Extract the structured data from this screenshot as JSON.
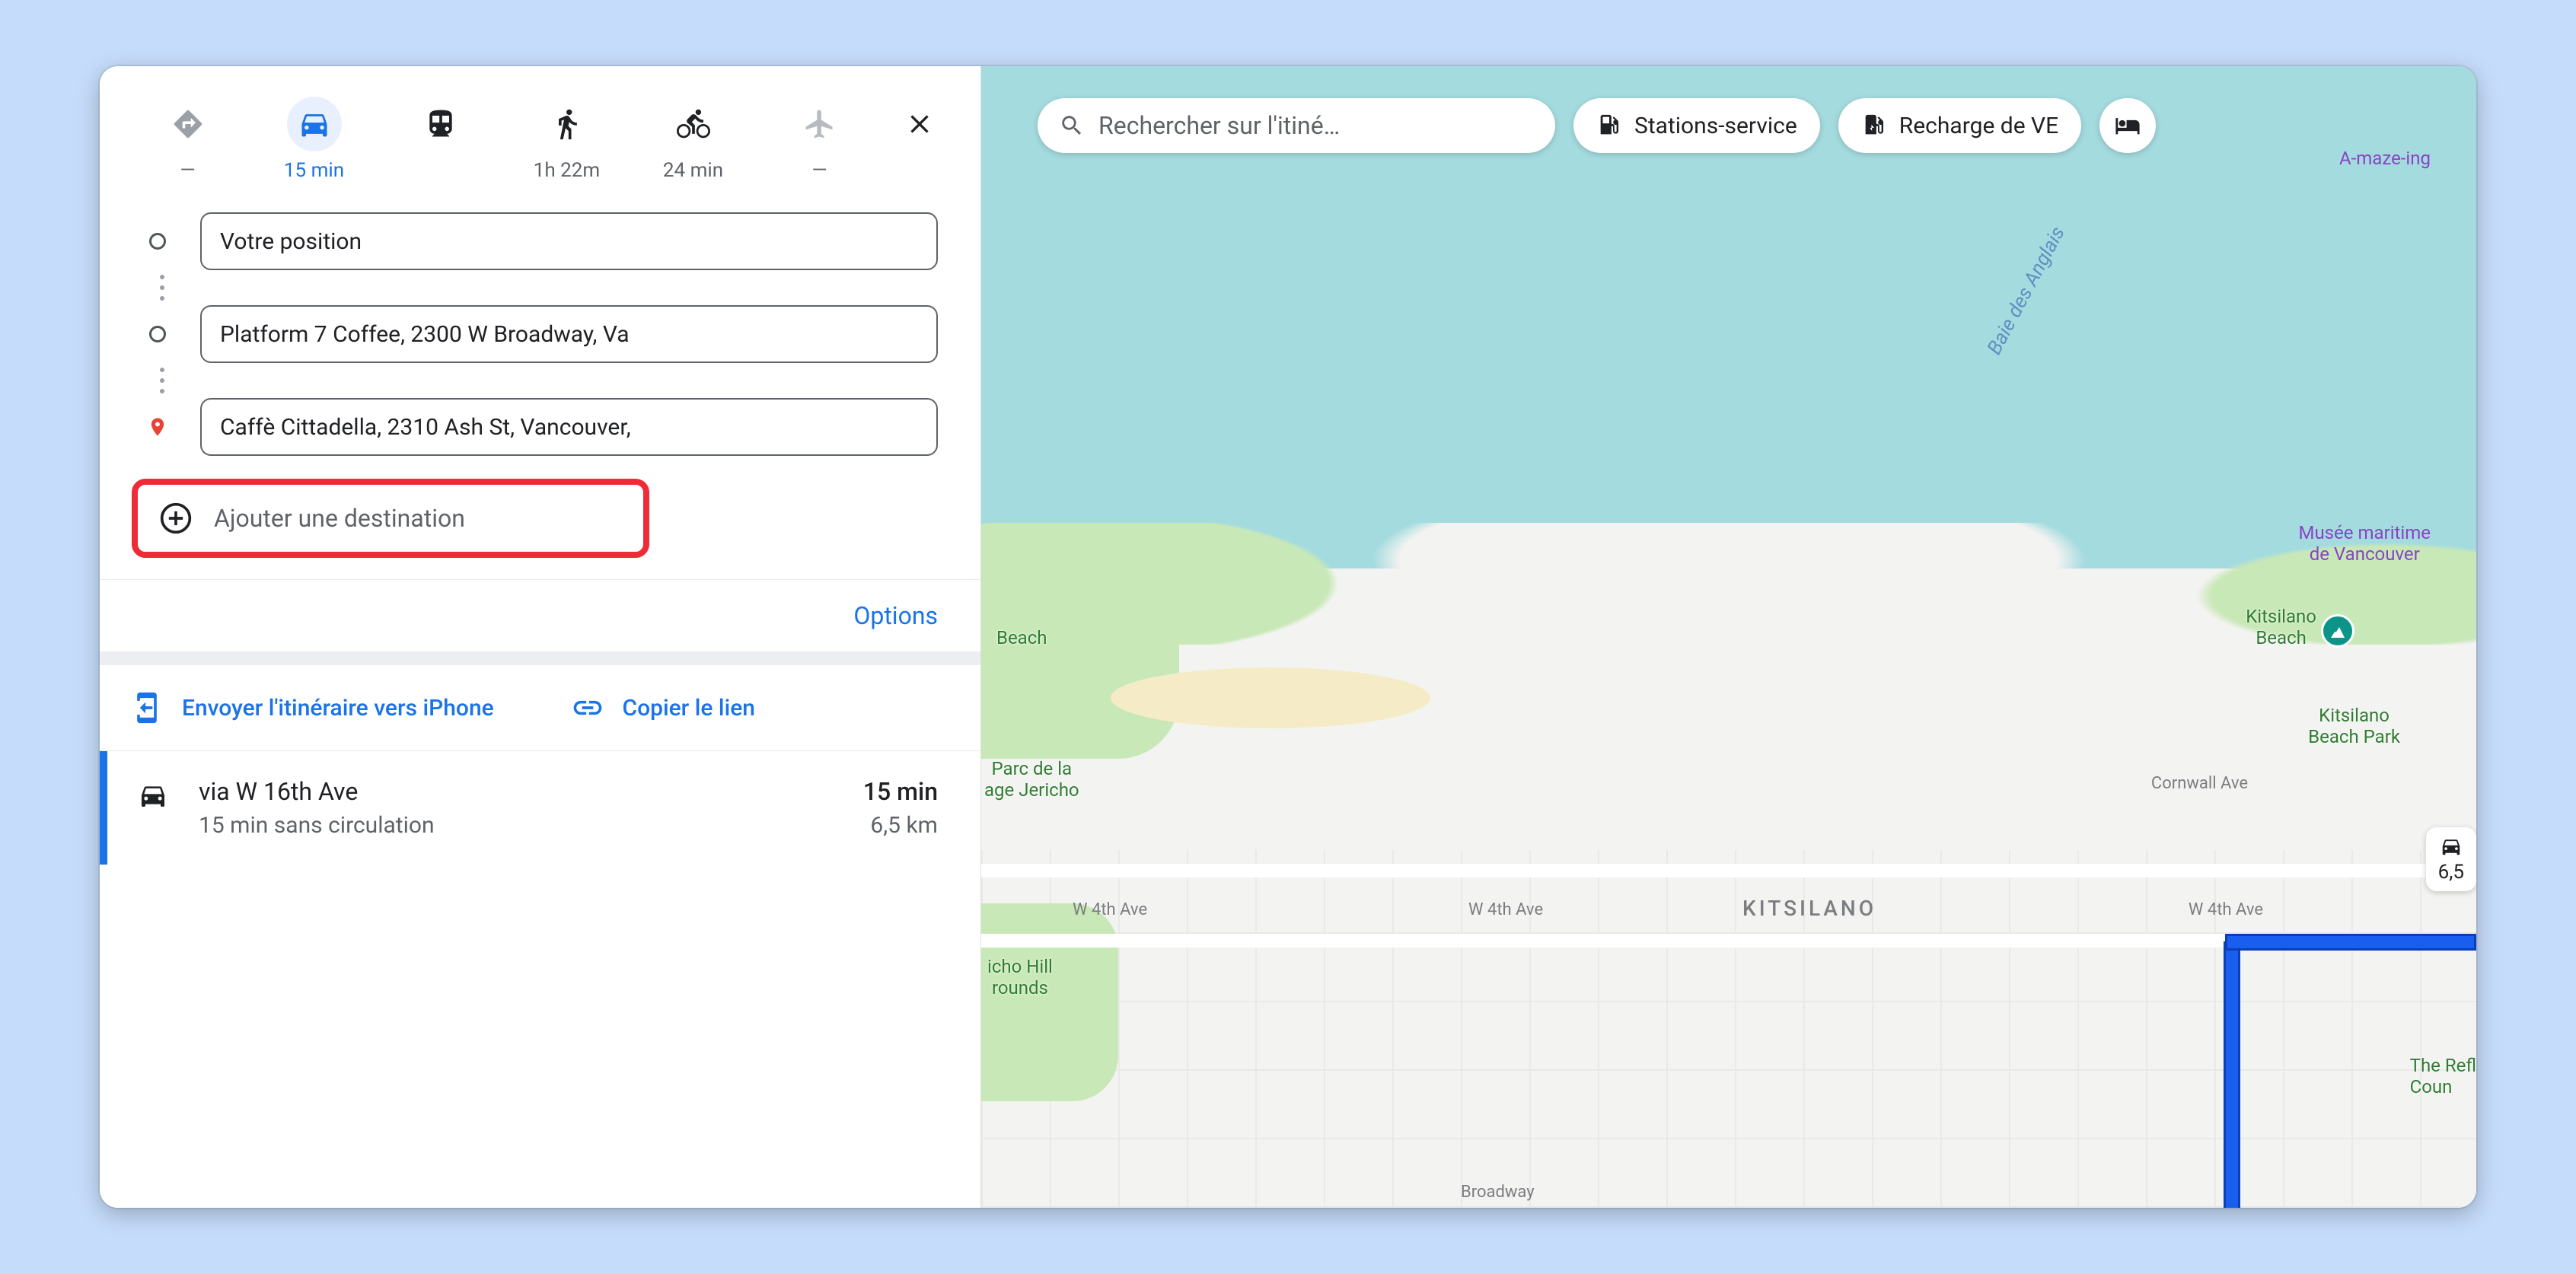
{
  "modes": {
    "best": {
      "time": "—"
    },
    "car": {
      "time": "15 min"
    },
    "transit": {
      "time": ""
    },
    "walk": {
      "time": "1h 22m"
    },
    "bike": {
      "time": "24 min"
    },
    "plane": {
      "time": "—"
    }
  },
  "waypoints": {
    "start": "Votre position",
    "mid": "Platform 7 Coffee, 2300 W Broadway, Va",
    "end": "Caffè Cittadella, 2310 Ash St, Vancouver,"
  },
  "add_destination": "Ajouter une destination",
  "options_label": "Options",
  "actions": {
    "send": "Envoyer l'itinéraire vers iPhone",
    "copy": "Copier le lien"
  },
  "route": {
    "title": "via W 16th Ave",
    "sub": "15 min sans circulation",
    "time": "15 min",
    "distance": "6,5 km"
  },
  "search_placeholder": "Rechercher sur l'itiné…",
  "chips": {
    "gas": "Stations-service",
    "ev": "Recharge de VE"
  },
  "map_labels": {
    "bay": "Baie des Anglais",
    "amaze": "A-maze-ing",
    "museum": "Musée maritime\nde Vancouver",
    "kits_beach": "Kitsilano\nBeach",
    "kits_park": "Kitsilano\nBeach Park",
    "cornwall": "Cornwall Ave",
    "beach": "Beach",
    "jericho": "Parc de la\nage Jericho",
    "w4th_1": "W 4th Ave",
    "w4th_2": "W 4th Ave",
    "w4th_3": "W 4th Ave",
    "kitsilano": "KITSILANO",
    "icho_hill": "icho Hill\nrounds",
    "reflecting": "The Refl\nCoun",
    "broadway": "Broadway"
  },
  "duration_chip": "6,5"
}
